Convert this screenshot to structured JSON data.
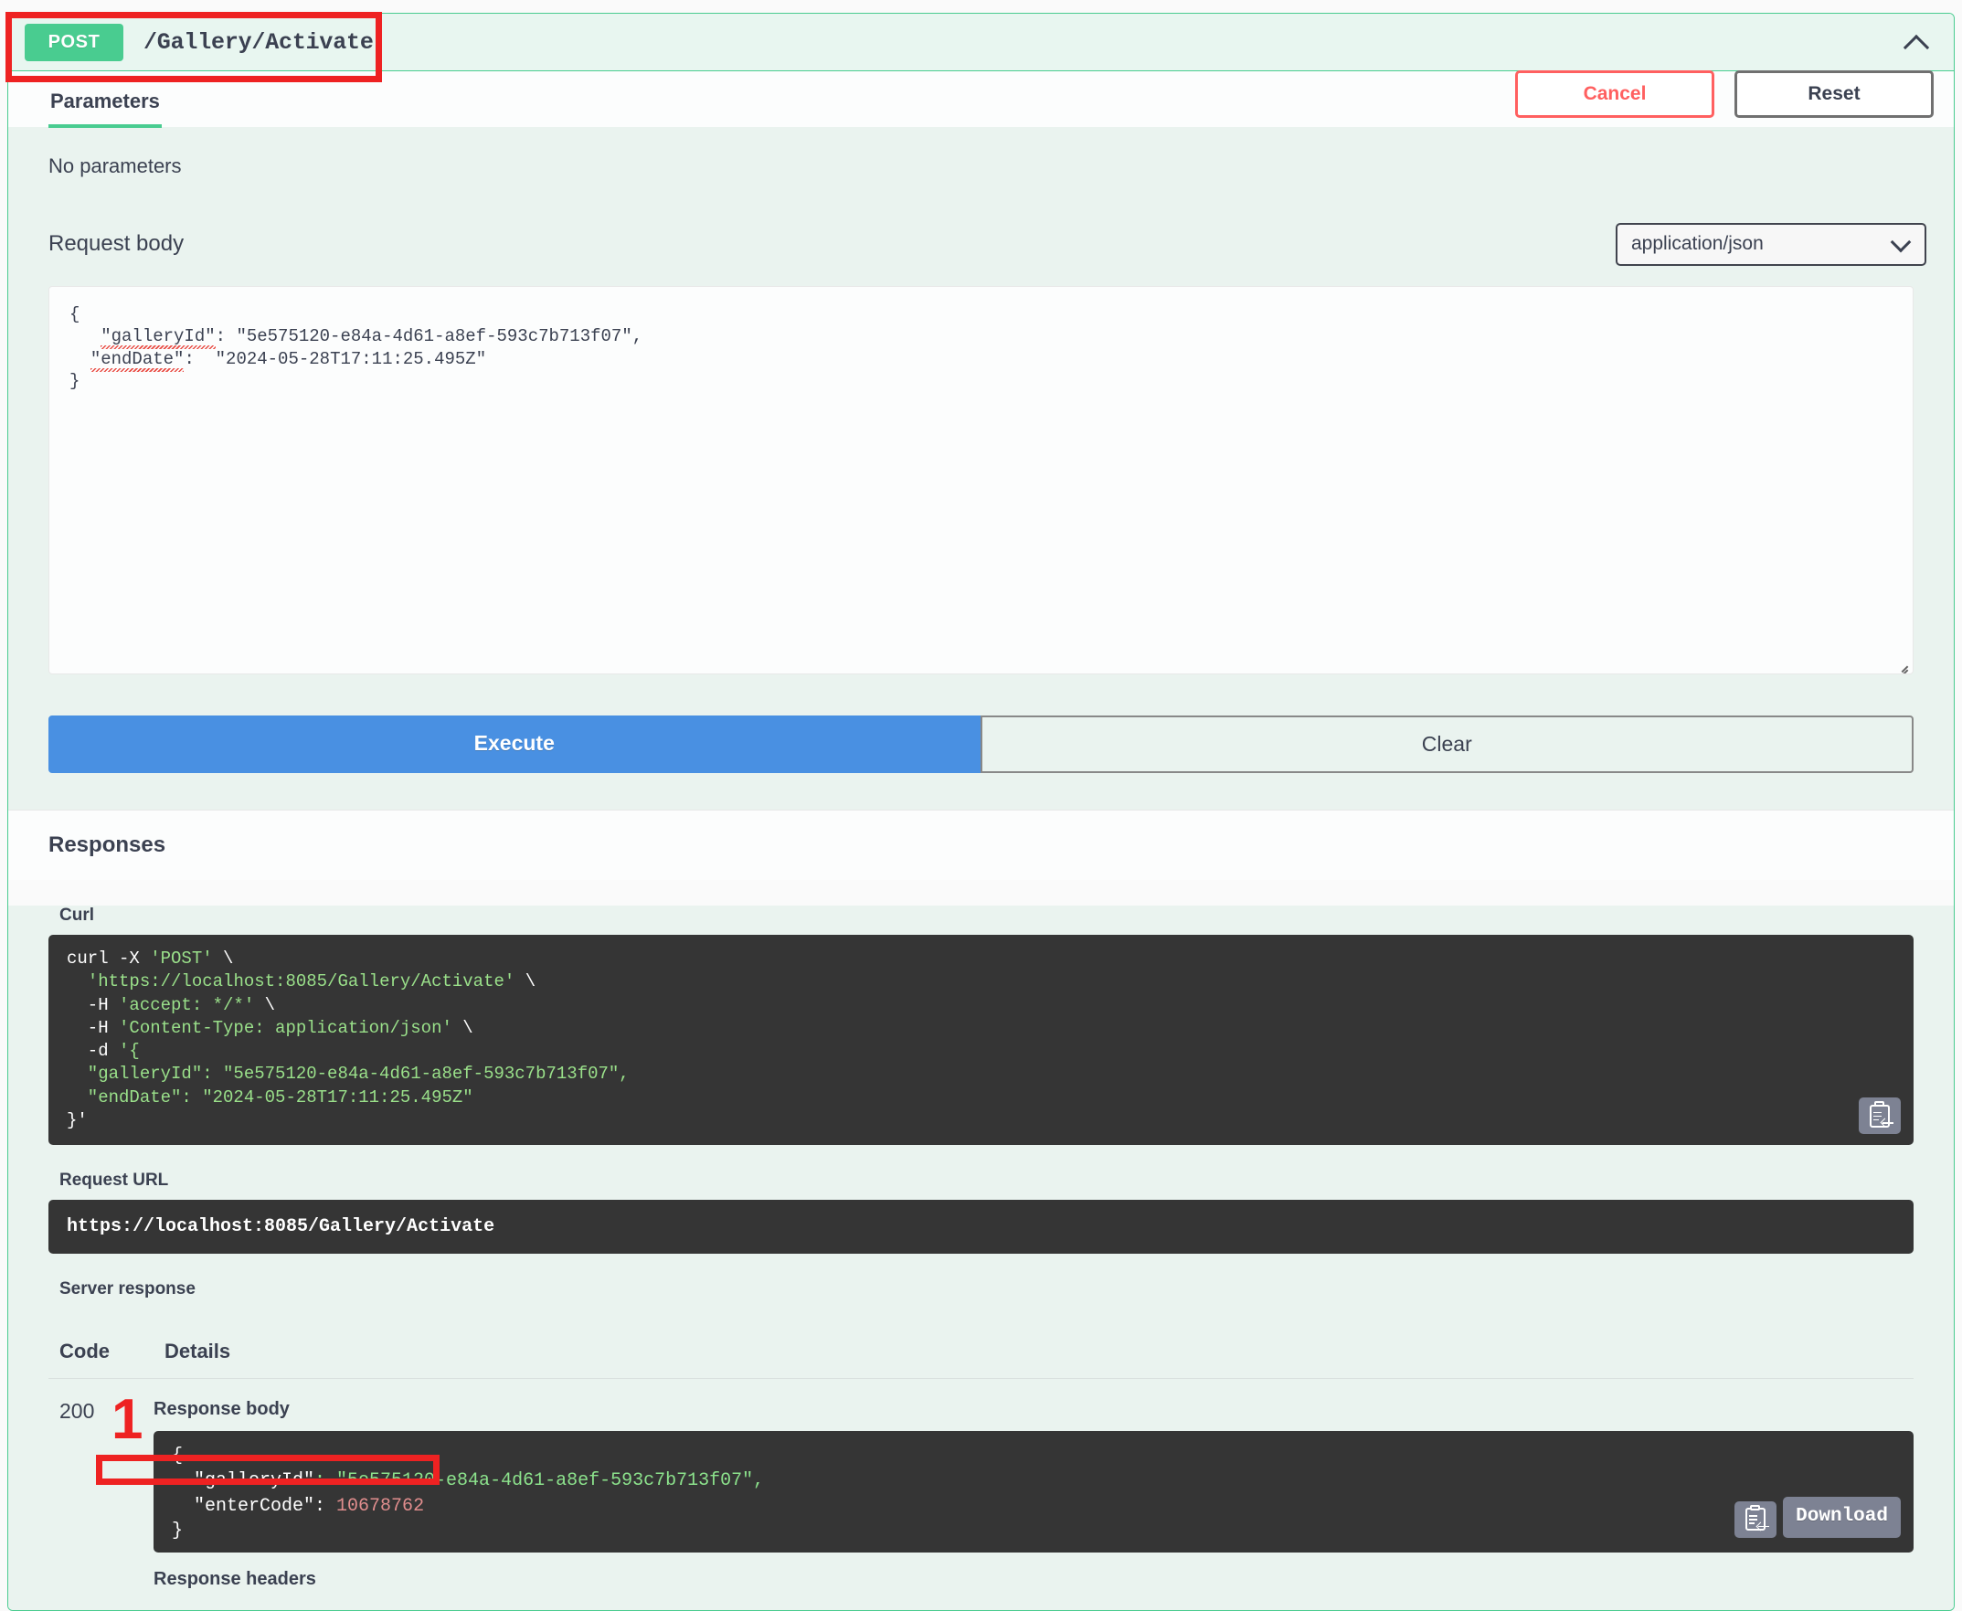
{
  "operation": {
    "method": "POST",
    "path": "/Gallery/Activate",
    "collapse_icon": "chevron-up-icon"
  },
  "tabs": {
    "parameters_label": "Parameters"
  },
  "actions": {
    "cancel_label": "Cancel",
    "reset_label": "Reset",
    "execute_label": "Execute",
    "clear_label": "Clear"
  },
  "parameters": {
    "empty_text": "No parameters"
  },
  "request_body": {
    "label": "Request body",
    "content_type": "application/json",
    "content_type_icon": "chevron-down-icon",
    "editor": {
      "line_open": "{",
      "key_gallery": "\"galleryId\"",
      "val_gallery": ": \"5e575120-e84a-4d61-a8ef-593c7b713f07\",",
      "key_enddate": "\"endDate\"",
      "val_enddate": ":  \"2024-05-28T17:11:25.495Z\"",
      "line_close": "}"
    }
  },
  "responses": {
    "heading": "Responses",
    "curl_label": "Curl",
    "curl": {
      "l1_cmd": "curl -X ",
      "l1_str": "'POST'",
      "l1_tail": " \\",
      "l2_str": "'https://localhost:8085/Gallery/Activate'",
      "l2_tail": " \\",
      "l3_cmd": "  -H ",
      "l3_str": "'accept: */*'",
      "l3_tail": " \\",
      "l4_cmd": "  -H ",
      "l4_str": "'Content-Type: application/json'",
      "l4_tail": " \\",
      "l5_cmd": "  -d ",
      "l5_str": "'{",
      "l6_str": "  \"galleryId\": \"5e575120-e84a-4d61-a8ef-593c7b713f07\",",
      "l7_str": "  \"endDate\": \"2024-05-28T17:11:25.495Z\"",
      "l8_str": "}'"
    },
    "curl_copy_icon": "copy-to-clipboard-icon",
    "request_url_label": "Request URL",
    "request_url": "https://localhost:8085/Gallery/Activate",
    "server_response_label": "Server response",
    "table_headers": {
      "code": "Code",
      "details": "Details"
    },
    "row": {
      "code": "200",
      "response_body_label": "Response body",
      "body_open": "{",
      "body_key_gallery": "  \"galleryId\"",
      "body_val_gallery": ": \"5e575120-e84a-4d61-a8ef-593c7b713f07\",",
      "body_key_entercode": "  \"enterCode\"",
      "body_val_entercode": " 10678762",
      "body_colon": ":",
      "body_close": "}",
      "copy_icon": "copy-to-clipboard-icon",
      "download_label": "Download",
      "response_headers_label": "Response headers"
    }
  },
  "annotations": {
    "marker_1": "1",
    "color": "#ee2222"
  }
}
